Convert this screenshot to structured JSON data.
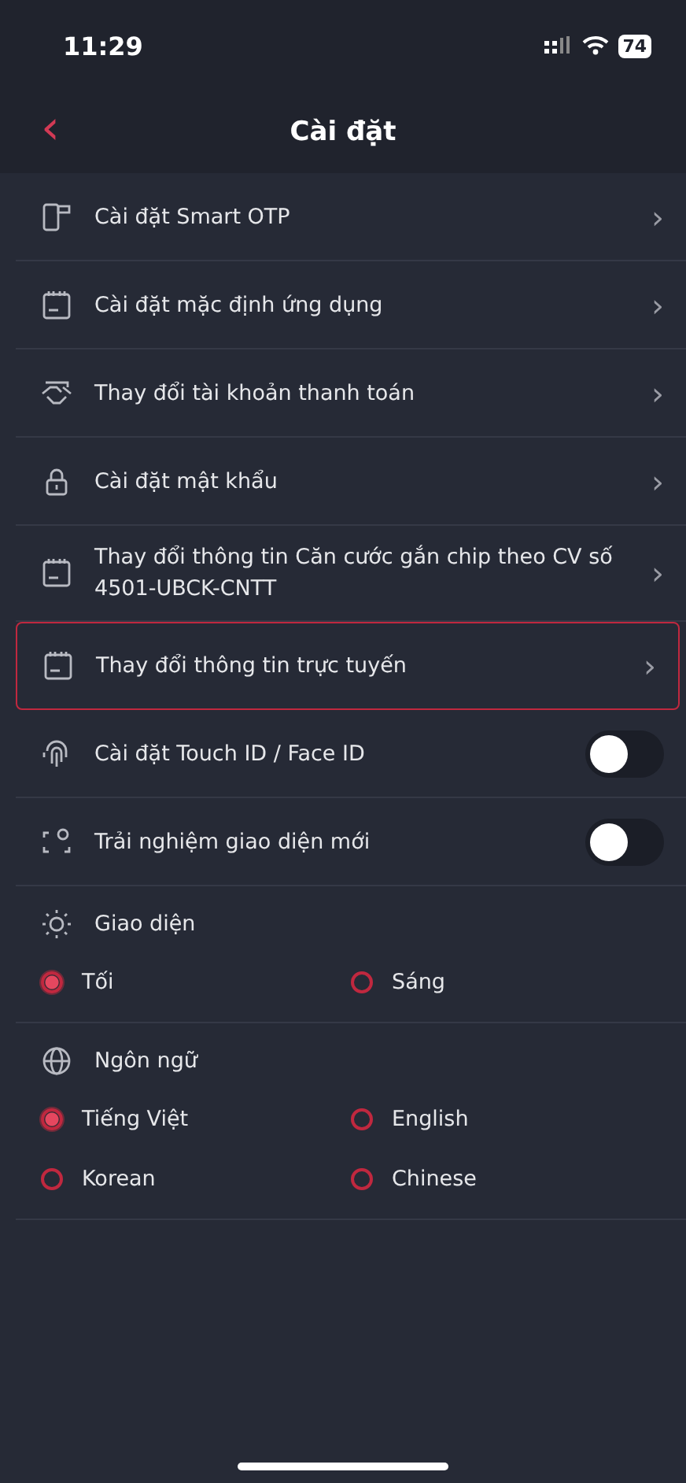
{
  "status_bar": {
    "time": "11:29",
    "battery": "74"
  },
  "header": {
    "back": "‹",
    "title": "Cài đặt"
  },
  "items": [
    {
      "kind": "link",
      "label": "Cài đặt Smart OTP",
      "chevron": "›",
      "highlighted": false
    },
    {
      "kind": "link",
      "label": "Cài đặt mặc định ứng dụng",
      "chevron": "›",
      "highlighted": false
    },
    {
      "kind": "link",
      "label": "Thay đổi tài khoản thanh toán",
      "chevron": "›",
      "highlighted": false
    },
    {
      "kind": "link",
      "label": "Cài đặt mật khẩu",
      "chevron": "›",
      "highlighted": false
    },
    {
      "kind": "link",
      "label": "Thay đổi thông tin Căn cước gắn chip theo CV số 4501-UBCK-CNTT",
      "chevron": "›",
      "highlighted": false
    },
    {
      "kind": "link",
      "label": "Thay đổi thông tin trực tuyến",
      "chevron": "›",
      "highlighted": true
    },
    {
      "kind": "toggle",
      "label": "Cài đặt Touch ID / Face ID",
      "on": false
    },
    {
      "kind": "toggle",
      "label": "Trải nghiệm giao diện mới",
      "on": false
    }
  ],
  "groups": [
    {
      "title": "Giao diện",
      "options": [
        {
          "label": "Tối",
          "selected": true
        },
        {
          "label": "Sáng",
          "selected": false
        }
      ]
    },
    {
      "title": "Ngôn ngữ",
      "options": [
        {
          "label": "Tiếng Việt",
          "selected": true
        },
        {
          "label": "English",
          "selected": false
        },
        {
          "label": "Korean",
          "selected": false
        },
        {
          "label": "Chinese",
          "selected": false
        }
      ]
    }
  ]
}
